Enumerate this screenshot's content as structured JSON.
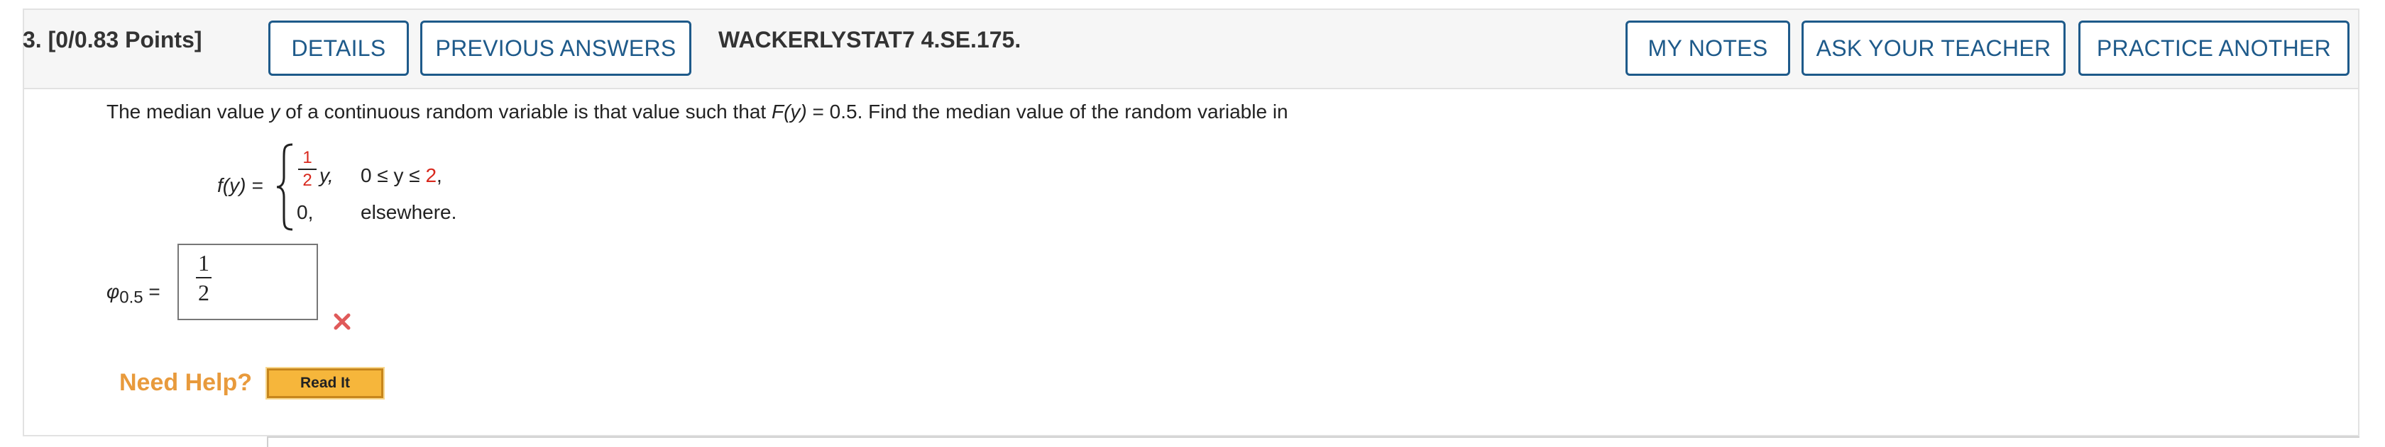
{
  "header": {
    "question_label": "3. [0/0.83 Points]",
    "details_label": "DETAILS",
    "previous_answers_label": "PREVIOUS ANSWERS",
    "assignment_id": "WACKERLYSTAT7 4.SE.175.",
    "my_notes_label": "MY NOTES",
    "ask_teacher_label": "ASK YOUR TEACHER",
    "practice_another_label": "PRACTICE ANOTHER"
  },
  "question": {
    "text_part1": "The median value ",
    "var_y": "y",
    "text_part2": " of a continuous random variable is that value such that ",
    "Fy": "F(y)",
    "text_part3": " = 0.5. Find the median value of the random variable in",
    "fy_label": "f(y) =",
    "frac_num": "1",
    "frac_den": "2",
    "case1_expr": "y,",
    "case1_cond_prefix": "0 ≤ y ≤ ",
    "case1_cond_value": "2",
    "case1_cond_suffix": ",",
    "case2_expr": "0,",
    "case2_cond": "elsewhere."
  },
  "answer": {
    "phi_symbol": "φ",
    "phi_subscript": "0.5",
    "equals": "=",
    "value_num": "1",
    "value_den": "2",
    "status": "incorrect"
  },
  "help": {
    "need_help_label": "Need Help?",
    "read_it_label": "Read It"
  },
  "colors": {
    "accent": "#1e5a8a",
    "error": "#d8281d",
    "help": "#e89a3c",
    "read_it_bg": "#f6b63b"
  }
}
